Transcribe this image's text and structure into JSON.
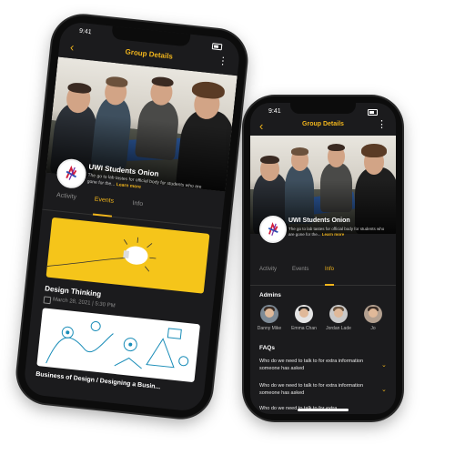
{
  "status": {
    "time": "9:41"
  },
  "header": {
    "title": "Group Details",
    "back_icon": "chevron-left-icon",
    "more_icon": "more-vertical-icon"
  },
  "group": {
    "name": "UWI Students Onion",
    "description": "The go to lab tastes for official body for students who are gone for the...",
    "learn_more": "Learn more"
  },
  "tabs": [
    "Activity",
    "Events",
    "Info"
  ],
  "left_phone": {
    "active_tab": "Events"
  },
  "right_phone": {
    "active_tab": "Info"
  },
  "events": [
    {
      "title": "Design Thinking",
      "date": "March 28, 2021 | 5:30 PM"
    },
    {
      "title": "Business of Design / Designing a Busin..."
    }
  ],
  "admins": {
    "heading": "Admins",
    "people": [
      {
        "name": "Danny Mike"
      },
      {
        "name": "Emma Chan"
      },
      {
        "name": "Jordan Lade"
      },
      {
        "name": "Jo"
      }
    ]
  },
  "faqs": {
    "heading": "FAQs",
    "items": [
      {
        "question": "Who do we need to talk to for extra information someone has asked"
      },
      {
        "question": "Who do we need to talk to for extra information someone has asked"
      },
      {
        "question": "Who do we need to talk to for extra"
      }
    ]
  },
  "colors": {
    "accent": "#f1b51c",
    "background": "#1b1b1d",
    "phone": "#0c0c0c",
    "card_yellow": "#f5c51a"
  }
}
